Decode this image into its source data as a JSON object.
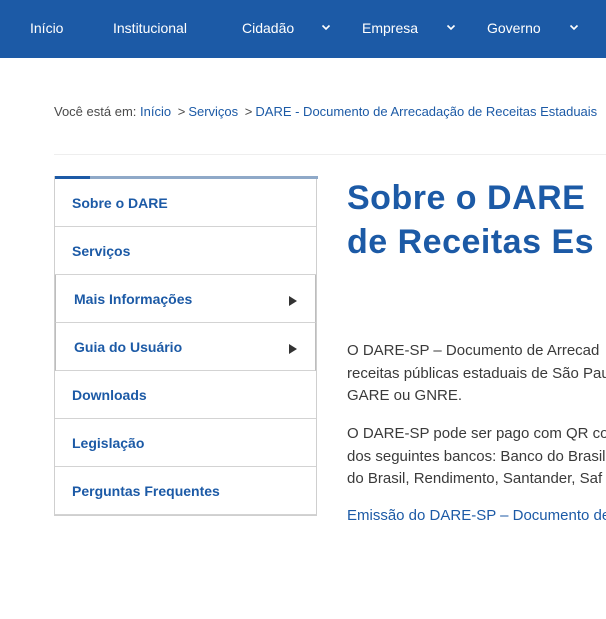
{
  "nav": {
    "items": [
      {
        "label": "Início",
        "has_menu": false
      },
      {
        "label": "Institucional",
        "has_menu": false
      },
      {
        "label": "Cidadão",
        "has_menu": true
      },
      {
        "label": "Empresa",
        "has_menu": true
      },
      {
        "label": "Governo",
        "has_menu": true
      }
    ]
  },
  "breadcrumb": {
    "prefix": "Você está em:",
    "separator": ">",
    "links": [
      "Início",
      "Serviços",
      "DARE - Documento de Arrecadação de Receitas Estaduais"
    ]
  },
  "sidebar": {
    "items": [
      {
        "label": "Sobre o DARE",
        "expandable": false
      },
      {
        "label": "Serviços",
        "expandable": false
      },
      {
        "label": "Mais Informações",
        "expandable": true
      },
      {
        "label": "Guia do Usuário",
        "expandable": true
      },
      {
        "label": "Downloads",
        "expandable": false
      },
      {
        "label": "Legislação",
        "expandable": false
      },
      {
        "label": "Perguntas Frequentes",
        "expandable": false
      }
    ]
  },
  "main": {
    "title_line1": "Sobre o DARE",
    "title_line2": "de Receitas Es",
    "p1": [
      "O DARE-SP – Documento de Arrecad",
      "receitas públicas estaduais de São Pau",
      "GARE ou GNRE."
    ],
    "p2": [
      "O DARE-SP pode ser pago com QR co",
      "dos seguintes bancos: Banco do Brasil",
      "do Brasil, Rendimento, Santander, Saf"
    ],
    "link": "Emissão do DARE-SP – Documento de"
  },
  "colors": {
    "brand_blue": "#1c5aa6",
    "text_gray": "#3a3a3a",
    "border_gray": "#cfcfcf"
  }
}
